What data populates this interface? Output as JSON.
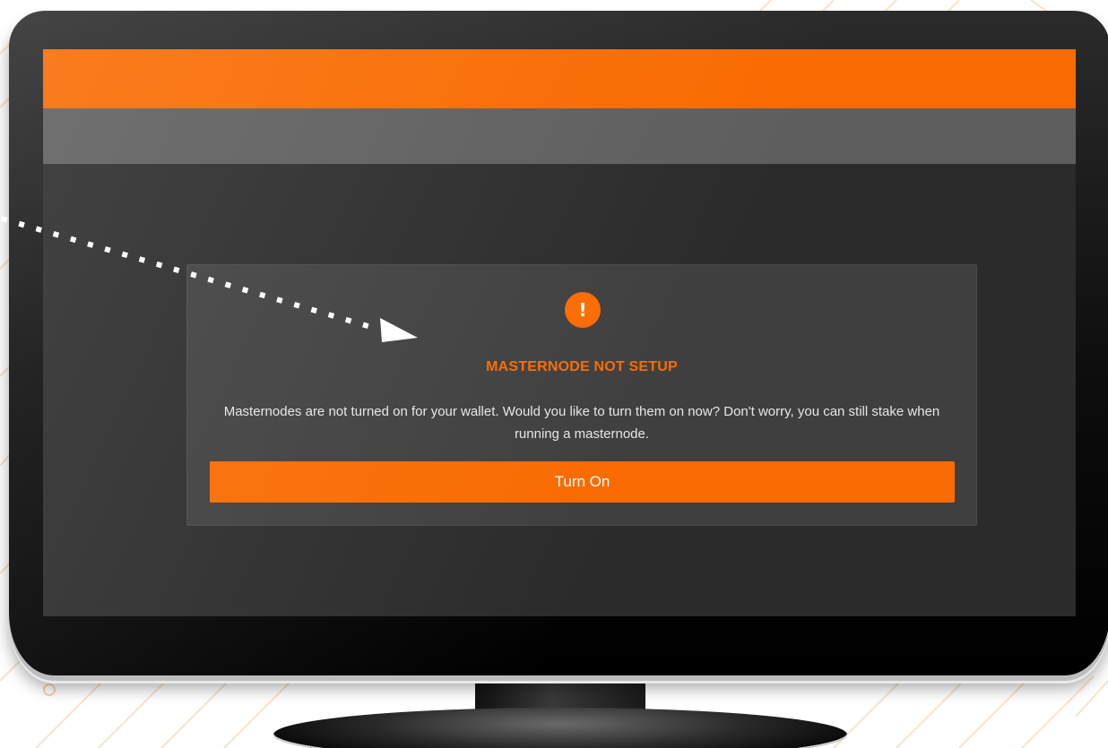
{
  "colors": {
    "accent": "#f96b01",
    "subbar": "#5e5e5e",
    "screen_bg": "#2b2b2b",
    "modal_bg": "#3f3f3f"
  },
  "icons": {
    "alert": "exclamation-icon",
    "pointer": "dotted-arrow-icon"
  },
  "alert_symbol": "!",
  "modal": {
    "title": "MASTERNODE NOT SETUP",
    "message": "Masternodes are not turned on for your wallet. Would you like to turn them on now? Don't worry, you can still stake when running a masternode.",
    "button_label": "Turn On"
  }
}
